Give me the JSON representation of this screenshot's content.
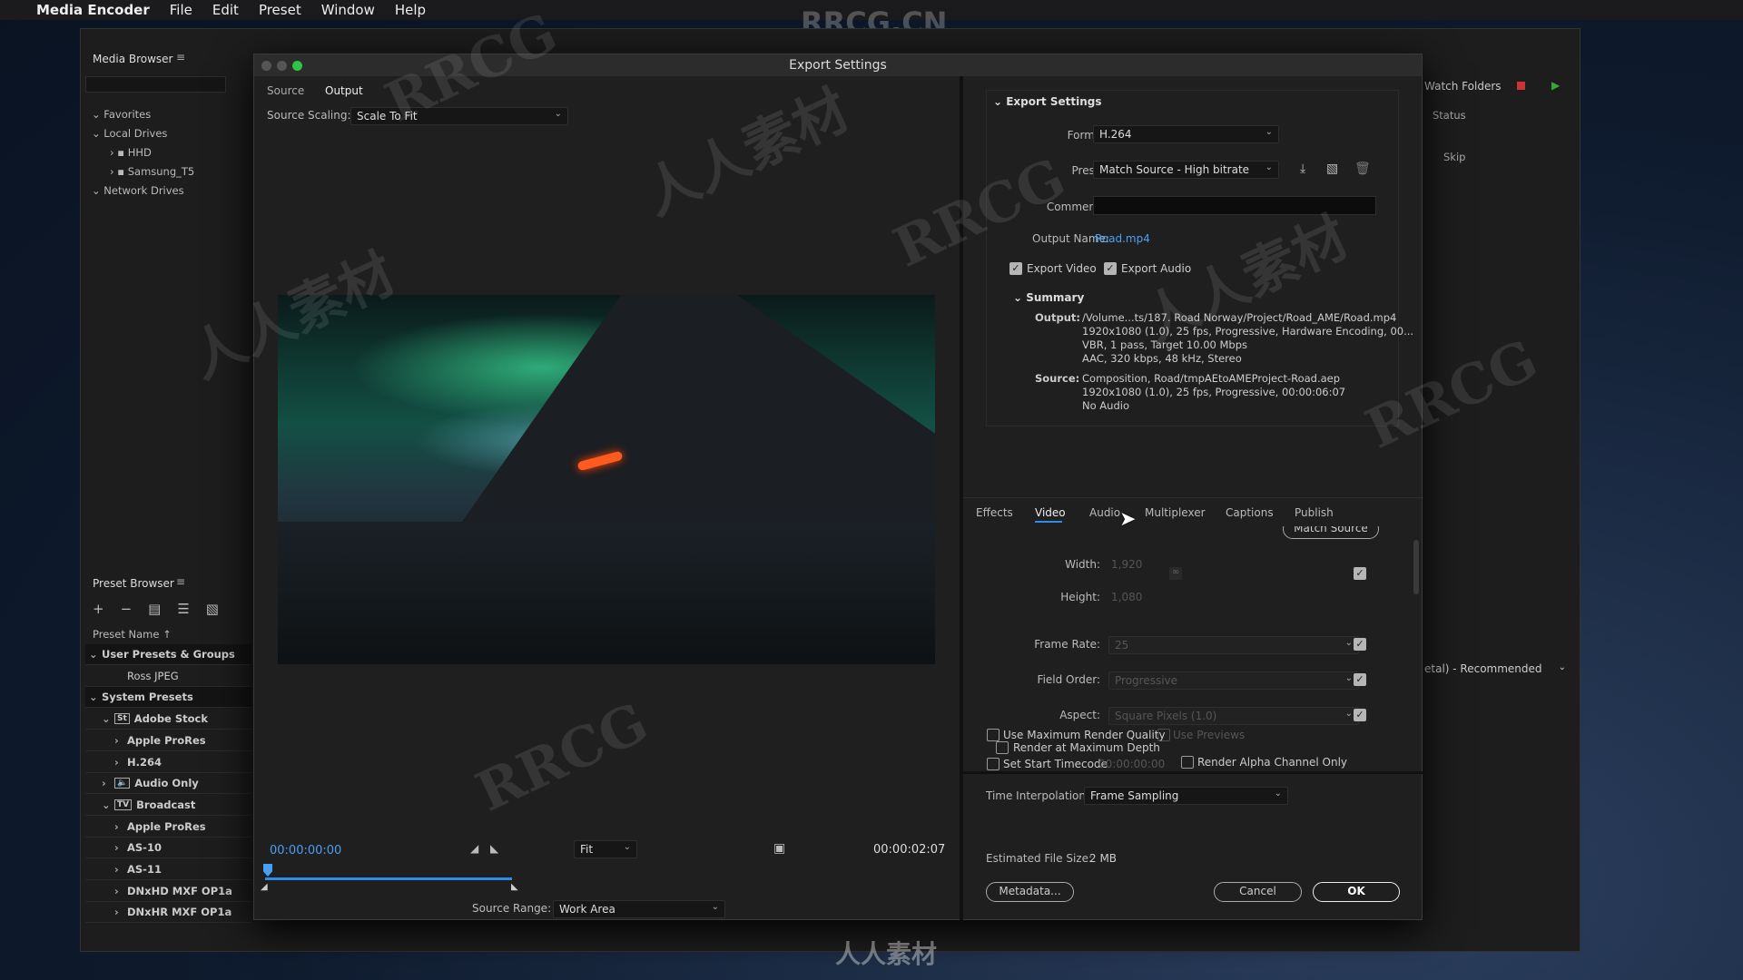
{
  "menubar": {
    "app": "Media Encoder",
    "items": [
      "File",
      "Edit",
      "Preset",
      "Window",
      "Help"
    ]
  },
  "watermark": {
    "top": "RRCG.CN",
    "marks": [
      "RRCG",
      "人人素材"
    ],
    "bottom": "人人素材"
  },
  "media_browser": {
    "title": "Media Browser",
    "tree": [
      "Favorites",
      "Local Drives",
      "HHD",
      "Samsung_T5",
      "Network Drives"
    ]
  },
  "preset_browser": {
    "title": "Preset Browser",
    "column": "Preset Name",
    "items": [
      {
        "label": "User Presets & Groups",
        "level": 0,
        "arrow": "down"
      },
      {
        "label": "Ross JPEG",
        "level": 2,
        "arrow": ""
      },
      {
        "label": "System Presets",
        "level": 0,
        "arrow": "down"
      },
      {
        "label": "Adobe Stock",
        "level": 1,
        "arrow": "down",
        "icon": "St"
      },
      {
        "label": "Apple ProRes",
        "level": 2,
        "arrow": "right"
      },
      {
        "label": "H.264",
        "level": 2,
        "arrow": "right"
      },
      {
        "label": "Audio Only",
        "level": 1,
        "arrow": "right",
        "icon": "🔈"
      },
      {
        "label": "Broadcast",
        "level": 1,
        "arrow": "down",
        "icon": "TV"
      },
      {
        "label": "Apple ProRes",
        "level": 2,
        "arrow": "right"
      },
      {
        "label": "AS-10",
        "level": 2,
        "arrow": "right"
      },
      {
        "label": "AS-11",
        "level": 2,
        "arrow": "right"
      },
      {
        "label": "DNxHD MXF OP1a",
        "level": 2,
        "arrow": "right"
      },
      {
        "label": "DNxHR MXF OP1a",
        "level": 2,
        "arrow": "right"
      }
    ]
  },
  "queue": {
    "watch_folders": "Watch Folders",
    "status": "Status",
    "skip": "Skip",
    "renderer": "etal) - Recommended"
  },
  "dialog": {
    "title": "Export Settings",
    "left_tabs": [
      "Source",
      "Output"
    ],
    "active_left_tab": "Output",
    "source_scaling_label": "Source Scaling:",
    "source_scaling": "Scale To Fit",
    "timecode_start": "00:00:00:00",
    "timecode_end": "00:00:02:07",
    "zoom": "Fit",
    "source_range_label": "Source Range:",
    "source_range": "Work Area",
    "export_settings": {
      "header": "Export Settings",
      "format_label": "Format:",
      "format": "H.264",
      "preset_label": "Preset:",
      "preset": "Match Source - High bitrate",
      "comments_label": "Comments:",
      "comments": "",
      "output_name_label": "Output Name:",
      "output_name": "Road.mp4",
      "export_video": "Export Video",
      "export_audio": "Export Audio"
    },
    "summary": {
      "header": "Summary",
      "output_label": "Output:",
      "output_lines": [
        "/Volume...ts/187. Road Norway/Project/Road_AME/Road.mp4",
        "1920x1080 (1.0), 25 fps, Progressive, Hardware Encoding, 00...",
        "VBR, 1 pass, Target 10.00 Mbps",
        "AAC, 320 kbps, 48 kHz, Stereo"
      ],
      "source_label": "Source:",
      "source_lines": [
        "Composition, Road/tmpAEtoAMEProject-Road.aep",
        "1920x1080 (1.0), 25 fps, Progressive, 00:00:06:07",
        "No Audio"
      ]
    },
    "tabs": [
      "Effects",
      "Video",
      "Audio",
      "Multiplexer",
      "Captions",
      "Publish"
    ],
    "active_tab": "Video",
    "video": {
      "match_source": "Match Source",
      "width_label": "Width:",
      "width": "1,920",
      "height_label": "Height:",
      "height": "1,080",
      "frame_rate_label": "Frame Rate:",
      "frame_rate": "25",
      "field_order_label": "Field Order:",
      "field_order": "Progressive",
      "aspect_label": "Aspect:",
      "aspect": "Square Pixels (1.0)",
      "render_max_depth": "Render at Maximum Depth"
    },
    "bottom": {
      "max_quality": "Use Maximum Render Quality",
      "use_previews": "Use Previews",
      "set_start_tc": "Set Start Timecode",
      "start_tc": "00:00:00:00",
      "alpha_only": "Render Alpha Channel Only",
      "time_interp_label": "Time Interpolation:",
      "time_interp": "Frame Sampling",
      "file_size_label": "Estimated File Size:",
      "file_size": "2 MB",
      "metadata": "Metadata...",
      "cancel": "Cancel",
      "ok": "OK"
    }
  },
  "colors": {
    "accent": "#2d8ceb",
    "link": "#4a9ff5",
    "timecode": "#4a9ff5"
  }
}
